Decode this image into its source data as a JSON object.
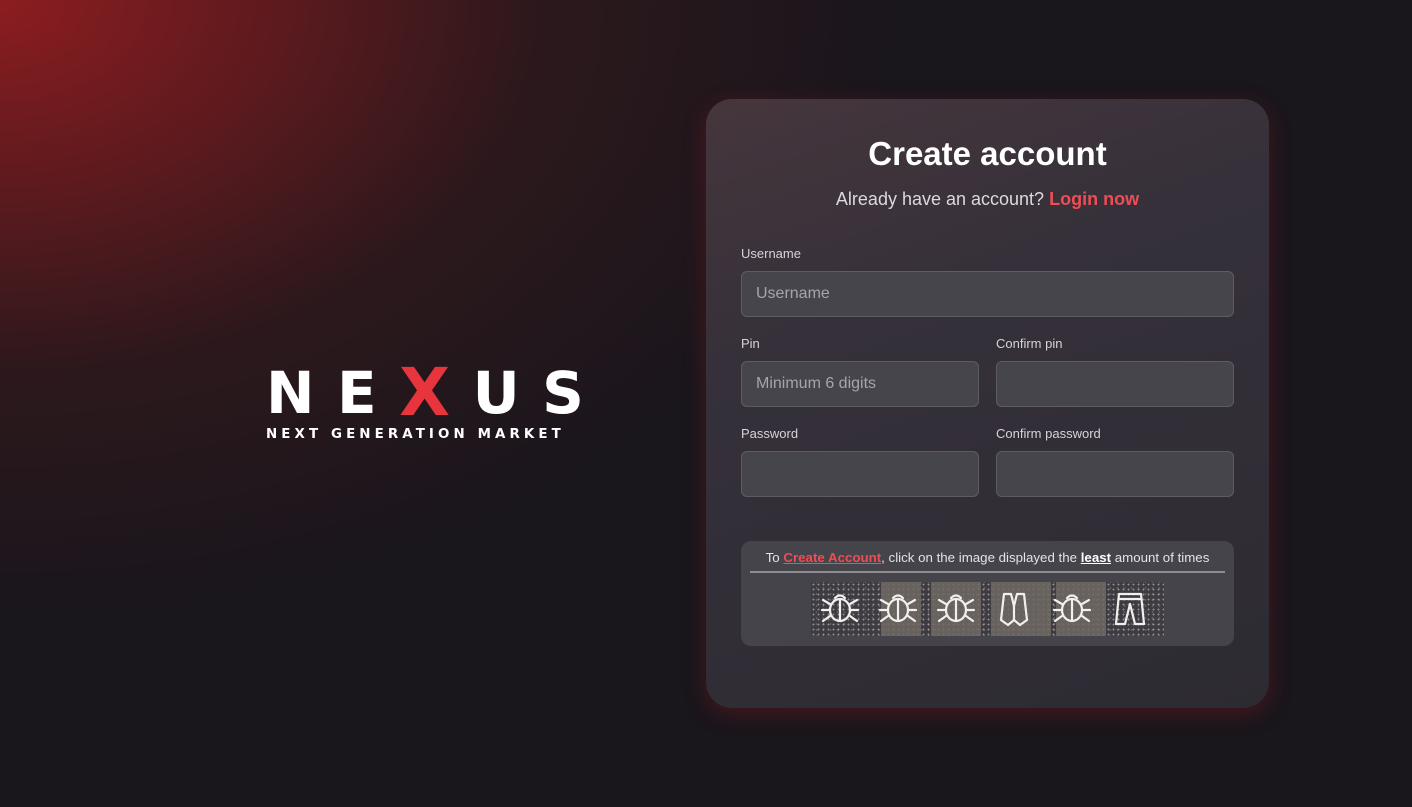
{
  "brand": {
    "logo_letters": [
      "N",
      "E",
      "X",
      "U",
      "S"
    ],
    "tagline": "NEXT GENERATION MARKET",
    "accent_color": "#e8353d"
  },
  "form": {
    "title": "Create account",
    "subtitle": "Already have an account?",
    "login_link": "Login now",
    "fields": {
      "username": {
        "label": "Username",
        "placeholder": "Username",
        "value": ""
      },
      "pin": {
        "label": "Pin",
        "placeholder": "Minimum 6 digits",
        "value": ""
      },
      "confirm_pin": {
        "label": "Confirm pin",
        "placeholder": "",
        "value": ""
      },
      "password": {
        "label": "Password",
        "placeholder": "",
        "value": ""
      },
      "confirm_password": {
        "label": "Confirm password",
        "placeholder": "",
        "value": ""
      }
    }
  },
  "captcha": {
    "prefix": "To",
    "action_link": "Create Account",
    "middle": ", click on the image displayed the",
    "emphasis": "least",
    "suffix": "amount of times",
    "images": [
      "beetle-icon",
      "beetle-icon",
      "beetle-icon",
      "vest-icon",
      "beetle-icon",
      "pants-icon"
    ]
  }
}
